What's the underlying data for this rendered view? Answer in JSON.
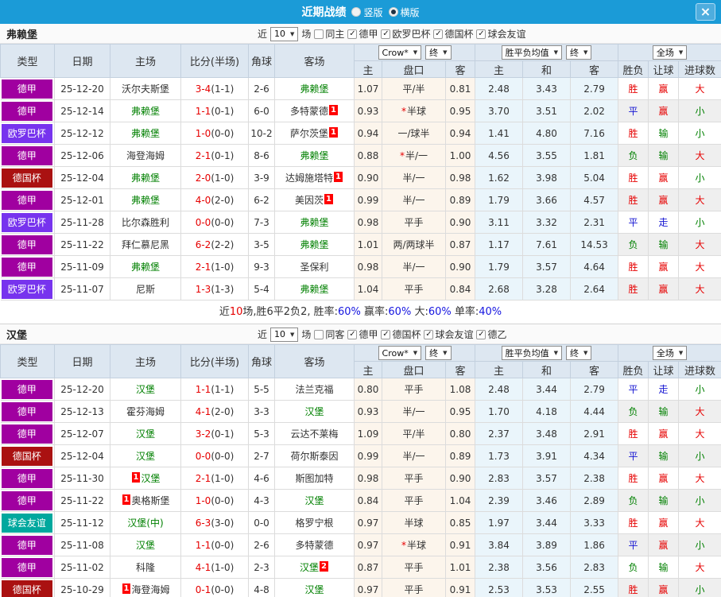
{
  "titlebar": {
    "title": "近期战绩",
    "vertical_label": "竖版",
    "horizontal_label": "横版",
    "close_label": "×"
  },
  "filter_labels": {
    "near": "近",
    "count": "10",
    "games": "场"
  },
  "dropdowns": {
    "bookmaker": "Crow*",
    "final": "终",
    "avg": "胜平负均值",
    "final2": "终",
    "scope": "全场",
    "arrow": "▼"
  },
  "marks": {
    "star": "*"
  },
  "columns": {
    "type": "类型",
    "date": "日期",
    "home": "主场",
    "score": "比分(半场)",
    "corner": "角球",
    "away": "客场",
    "ah_home": "主",
    "handicap": "盘口",
    "ah_away": "客",
    "odds_home": "主",
    "odds_draw": "和",
    "odds_away": "客",
    "result": "胜负",
    "ah_result": "让球",
    "goal_result": "进球数"
  },
  "type_colors": {
    "德甲": "#a000a0",
    "欧罗巴杯": "#7733ee",
    "德国杯": "#aa1111",
    "球会友谊": "#00a89e"
  },
  "result_colors": {
    "胜": "#e60000",
    "平": "#1414d2",
    "负": "#008000",
    "赢": "#e60000",
    "走": "#1414d2",
    "输": "#008000",
    "大": "#e60000",
    "小": "#008000"
  },
  "sections": [
    {
      "team": "弗赖堡",
      "same_label": "同主",
      "leagues": [
        "德甲",
        "欧罗巴杯",
        "德国杯",
        "球会友谊"
      ],
      "rows": [
        {
          "type": "德甲",
          "date": "25-12-20",
          "home": "沃尔夫斯堡",
          "home_green": false,
          "score": "3-4",
          "half": "(1-1)",
          "corner": "2-6",
          "away": "弗赖堡",
          "away_green": true,
          "ah_home": "1.07",
          "handicap": "平/半",
          "handicap_star": false,
          "ah_away": "0.81",
          "odds_home": "2.48",
          "odds_draw": "3.43",
          "odds_away": "2.79",
          "res": "胜",
          "res_ah": "赢",
          "res_goal": "大"
        },
        {
          "type": "德甲",
          "date": "25-12-14",
          "home": "弗赖堡",
          "home_green": true,
          "score": "1-1",
          "half": "(0-1)",
          "corner": "6-0",
          "away": "多特蒙德",
          "away_green": false,
          "away_badge": "1",
          "away_badge_pos": "after",
          "ah_home": "0.93",
          "handicap": "半球",
          "handicap_star": true,
          "ah_away": "0.95",
          "odds_home": "3.70",
          "odds_draw": "3.51",
          "odds_away": "2.02",
          "res": "平",
          "res_ah": "赢",
          "res_goal": "小"
        },
        {
          "type": "欧罗巴杯",
          "date": "25-12-12",
          "home": "弗赖堡",
          "home_green": true,
          "score": "1-0",
          "half": "(0-0)",
          "corner": "10-2",
          "away": "萨尔茨堡",
          "away_green": false,
          "away_badge": "1",
          "away_badge_pos": "after",
          "ah_home": "0.94",
          "handicap": "一/球半",
          "handicap_star": false,
          "ah_away": "0.94",
          "odds_home": "1.41",
          "odds_draw": "4.80",
          "odds_away": "7.16",
          "res": "胜",
          "res_ah": "输",
          "res_goal": "小"
        },
        {
          "type": "德甲",
          "date": "25-12-06",
          "home": "海登海姆",
          "home_green": false,
          "score": "2-1",
          "half": "(0-1)",
          "corner": "8-6",
          "away": "弗赖堡",
          "away_green": true,
          "ah_home": "0.88",
          "handicap": "半/一",
          "handicap_star": true,
          "ah_away": "1.00",
          "odds_home": "4.56",
          "odds_draw": "3.55",
          "odds_away": "1.81",
          "res": "负",
          "res_ah": "输",
          "res_goal": "大"
        },
        {
          "type": "德国杯",
          "date": "25-12-04",
          "home": "弗赖堡",
          "home_green": true,
          "score": "2-0",
          "half": "(1-0)",
          "corner": "3-9",
          "away": "达姆施塔特",
          "away_green": false,
          "away_badge": "1",
          "away_badge_pos": "after",
          "ah_home": "0.90",
          "handicap": "半/一",
          "handicap_star": false,
          "ah_away": "0.98",
          "odds_home": "1.62",
          "odds_draw": "3.98",
          "odds_away": "5.04",
          "res": "胜",
          "res_ah": "赢",
          "res_goal": "小"
        },
        {
          "type": "德甲",
          "date": "25-12-01",
          "home": "弗赖堡",
          "home_green": true,
          "score": "4-0",
          "half": "(2-0)",
          "corner": "6-2",
          "away": "美因茨",
          "away_green": false,
          "away_badge": "1",
          "away_badge_pos": "after",
          "ah_home": "0.99",
          "handicap": "半/一",
          "handicap_star": false,
          "ah_away": "0.89",
          "odds_home": "1.79",
          "odds_draw": "3.66",
          "odds_away": "4.57",
          "res": "胜",
          "res_ah": "赢",
          "res_goal": "大"
        },
        {
          "type": "欧罗巴杯",
          "date": "25-11-28",
          "home": "比尔森胜利",
          "home_green": false,
          "score": "0-0",
          "half": "(0-0)",
          "corner": "7-3",
          "away": "弗赖堡",
          "away_green": true,
          "ah_home": "0.98",
          "handicap": "平手",
          "handicap_star": false,
          "ah_away": "0.90",
          "odds_home": "3.11",
          "odds_draw": "3.32",
          "odds_away": "2.31",
          "res": "平",
          "res_ah": "走",
          "res_goal": "小"
        },
        {
          "type": "德甲",
          "date": "25-11-22",
          "home": "拜仁慕尼黑",
          "home_green": false,
          "score": "6-2",
          "half": "(2-2)",
          "corner": "3-5",
          "away": "弗赖堡",
          "away_green": true,
          "ah_home": "1.01",
          "handicap": "两/两球半",
          "handicap_star": false,
          "ah_away": "0.87",
          "odds_home": "1.17",
          "odds_draw": "7.61",
          "odds_away": "14.53",
          "res": "负",
          "res_ah": "输",
          "res_goal": "大"
        },
        {
          "type": "德甲",
          "date": "25-11-09",
          "home": "弗赖堡",
          "home_green": true,
          "score": "2-1",
          "half": "(1-0)",
          "corner": "9-3",
          "away": "圣保利",
          "away_green": false,
          "ah_home": "0.98",
          "handicap": "半/一",
          "handicap_star": false,
          "ah_away": "0.90",
          "odds_home": "1.79",
          "odds_draw": "3.57",
          "odds_away": "4.64",
          "res": "胜",
          "res_ah": "赢",
          "res_goal": "大"
        },
        {
          "type": "欧罗巴杯",
          "date": "25-11-07",
          "home": "尼斯",
          "home_green": false,
          "score": "1-3",
          "half": "(1-3)",
          "corner": "5-4",
          "away": "弗赖堡",
          "away_green": true,
          "ah_home": "1.04",
          "handicap": "平手",
          "handicap_star": false,
          "ah_away": "0.84",
          "odds_home": "2.68",
          "odds_draw": "3.28",
          "odds_away": "2.64",
          "res": "胜",
          "res_ah": "赢",
          "res_goal": "大"
        }
      ],
      "summary": [
        {
          "t": "近",
          "c": "#333333"
        },
        {
          "t": "10",
          "c": "#e60000"
        },
        {
          "t": "场,胜6平2负2, 胜率:",
          "c": "#333333"
        },
        {
          "t": "60%",
          "c": "#1414e0"
        },
        {
          "t": " 赢率:",
          "c": "#333333"
        },
        {
          "t": "60%",
          "c": "#1414e0"
        },
        {
          "t": " 大:",
          "c": "#333333"
        },
        {
          "t": "60%",
          "c": "#1414e0"
        },
        {
          "t": " 单率:",
          "c": "#333333"
        },
        {
          "t": "40%",
          "c": "#1414e0"
        }
      ]
    },
    {
      "team": "汉堡",
      "same_label": "同客",
      "leagues": [
        "德甲",
        "德国杯",
        "球会友谊",
        "德乙"
      ],
      "rows": [
        {
          "type": "德甲",
          "date": "25-12-20",
          "home": "汉堡",
          "home_green": true,
          "score": "1-1",
          "half": "(1-1)",
          "corner": "5-5",
          "away": "法兰克福",
          "away_green": false,
          "ah_home": "0.80",
          "handicap": "平手",
          "handicap_star": false,
          "ah_away": "1.08",
          "odds_home": "2.48",
          "odds_draw": "3.44",
          "odds_away": "2.79",
          "res": "平",
          "res_ah": "走",
          "res_goal": "小"
        },
        {
          "type": "德甲",
          "date": "25-12-13",
          "home": "霍芬海姆",
          "home_green": false,
          "score": "4-1",
          "half": "(2-0)",
          "corner": "3-3",
          "away": "汉堡",
          "away_green": true,
          "ah_home": "0.93",
          "handicap": "半/一",
          "handicap_star": false,
          "ah_away": "0.95",
          "odds_home": "1.70",
          "odds_draw": "4.18",
          "odds_away": "4.44",
          "res": "负",
          "res_ah": "输",
          "res_goal": "大"
        },
        {
          "type": "德甲",
          "date": "25-12-07",
          "home": "汉堡",
          "home_green": true,
          "score": "3-2",
          "half": "(0-1)",
          "corner": "5-3",
          "away": "云达不莱梅",
          "away_green": false,
          "ah_home": "1.09",
          "handicap": "平/半",
          "handicap_star": false,
          "ah_away": "0.80",
          "odds_home": "2.37",
          "odds_draw": "3.48",
          "odds_away": "2.91",
          "res": "胜",
          "res_ah": "赢",
          "res_goal": "大"
        },
        {
          "type": "德国杯",
          "date": "25-12-04",
          "home": "汉堡",
          "home_green": true,
          "score": "0-0",
          "half": "(0-0)",
          "corner": "2-7",
          "away": "荷尔斯泰因",
          "away_green": false,
          "ah_home": "0.99",
          "handicap": "半/一",
          "handicap_star": false,
          "ah_away": "0.89",
          "odds_home": "1.73",
          "odds_draw": "3.91",
          "odds_away": "4.34",
          "res": "平",
          "res_ah": "输",
          "res_goal": "小"
        },
        {
          "type": "德甲",
          "date": "25-11-30",
          "home": "汉堡",
          "home_green": true,
          "home_badge": "1",
          "home_badge_pos": "before",
          "score": "2-1",
          "half": "(1-0)",
          "corner": "4-6",
          "away": "斯图加特",
          "away_green": false,
          "ah_home": "0.98",
          "handicap": "平手",
          "handicap_star": false,
          "ah_away": "0.90",
          "odds_home": "2.83",
          "odds_draw": "3.57",
          "odds_away": "2.38",
          "res": "胜",
          "res_ah": "赢",
          "res_goal": "大"
        },
        {
          "type": "德甲",
          "date": "25-11-22",
          "home": "奥格斯堡",
          "home_green": false,
          "home_badge": "1",
          "home_badge_pos": "before",
          "score": "1-0",
          "half": "(0-0)",
          "corner": "4-3",
          "away": "汉堡",
          "away_green": true,
          "ah_home": "0.84",
          "handicap": "平手",
          "handicap_star": false,
          "ah_away": "1.04",
          "odds_home": "2.39",
          "odds_draw": "3.46",
          "odds_away": "2.89",
          "res": "负",
          "res_ah": "输",
          "res_goal": "小"
        },
        {
          "type": "球会友谊",
          "date": "25-11-12",
          "home": "汉堡(中)",
          "home_green": true,
          "score": "6-3",
          "half": "(3-0)",
          "corner": "0-0",
          "away": "格罗宁根",
          "away_green": false,
          "ah_home": "0.97",
          "handicap": "半球",
          "handicap_star": false,
          "ah_away": "0.85",
          "odds_home": "1.97",
          "odds_draw": "3.44",
          "odds_away": "3.33",
          "res": "胜",
          "res_ah": "赢",
          "res_goal": "大"
        },
        {
          "type": "德甲",
          "date": "25-11-08",
          "home": "汉堡",
          "home_green": true,
          "score": "1-1",
          "half": "(0-0)",
          "corner": "2-6",
          "away": "多特蒙德",
          "away_green": false,
          "ah_home": "0.97",
          "handicap": "半球",
          "handicap_star": true,
          "ah_away": "0.91",
          "odds_home": "3.84",
          "odds_draw": "3.89",
          "odds_away": "1.86",
          "res": "平",
          "res_ah": "赢",
          "res_goal": "小"
        },
        {
          "type": "德甲",
          "date": "25-11-02",
          "home": "科隆",
          "home_green": false,
          "score": "4-1",
          "half": "(1-0)",
          "corner": "2-3",
          "away": "汉堡",
          "away_green": true,
          "away_badge": "2",
          "away_badge_pos": "after",
          "ah_home": "0.87",
          "handicap": "平手",
          "handicap_star": false,
          "ah_away": "1.01",
          "odds_home": "2.38",
          "odds_draw": "3.56",
          "odds_away": "2.83",
          "res": "负",
          "res_ah": "输",
          "res_goal": "大"
        },
        {
          "type": "德国杯",
          "date": "25-10-29",
          "home": "海登海姆",
          "home_green": false,
          "home_badge": "1",
          "home_badge_pos": "before",
          "score": "0-1",
          "half": "(0-0)",
          "corner": "4-8",
          "away": "汉堡",
          "away_green": true,
          "ah_home": "0.97",
          "handicap": "平手",
          "handicap_star": false,
          "ah_away": "0.91",
          "odds_home": "2.53",
          "odds_draw": "3.53",
          "odds_away": "2.55",
          "res": "胜",
          "res_ah": "赢",
          "res_goal": "小"
        }
      ],
      "summary": null
    }
  ]
}
